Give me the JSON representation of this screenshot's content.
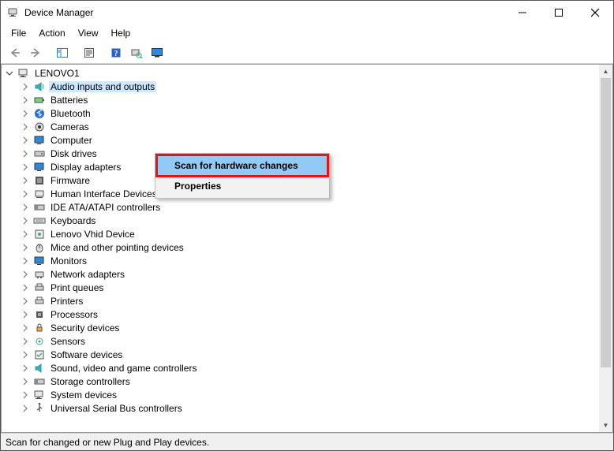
{
  "window": {
    "title": "Device Manager"
  },
  "menu": {
    "file": "File",
    "action": "Action",
    "view": "View",
    "help": "Help"
  },
  "tree": {
    "root_label": "LENOVO1",
    "items": [
      {
        "label": "Audio inputs and outputs",
        "selected": true
      },
      {
        "label": "Batteries"
      },
      {
        "label": "Bluetooth"
      },
      {
        "label": "Cameras"
      },
      {
        "label": "Computer"
      },
      {
        "label": "Disk drives"
      },
      {
        "label": "Display adapters"
      },
      {
        "label": "Firmware"
      },
      {
        "label": "Human Interface Devices"
      },
      {
        "label": "IDE ATA/ATAPI controllers"
      },
      {
        "label": "Keyboards"
      },
      {
        "label": "Lenovo Vhid Device"
      },
      {
        "label": "Mice and other pointing devices"
      },
      {
        "label": "Monitors"
      },
      {
        "label": "Network adapters"
      },
      {
        "label": "Print queues"
      },
      {
        "label": "Printers"
      },
      {
        "label": "Processors"
      },
      {
        "label": "Security devices"
      },
      {
        "label": "Sensors"
      },
      {
        "label": "Software devices"
      },
      {
        "label": "Sound, video and game controllers"
      },
      {
        "label": "Storage controllers"
      },
      {
        "label": "System devices"
      },
      {
        "label": "Universal Serial Bus controllers"
      }
    ]
  },
  "context_menu": {
    "scan": "Scan for hardware changes",
    "properties": "Properties"
  },
  "status": {
    "text": "Scan for changed or new Plug and Play devices."
  }
}
